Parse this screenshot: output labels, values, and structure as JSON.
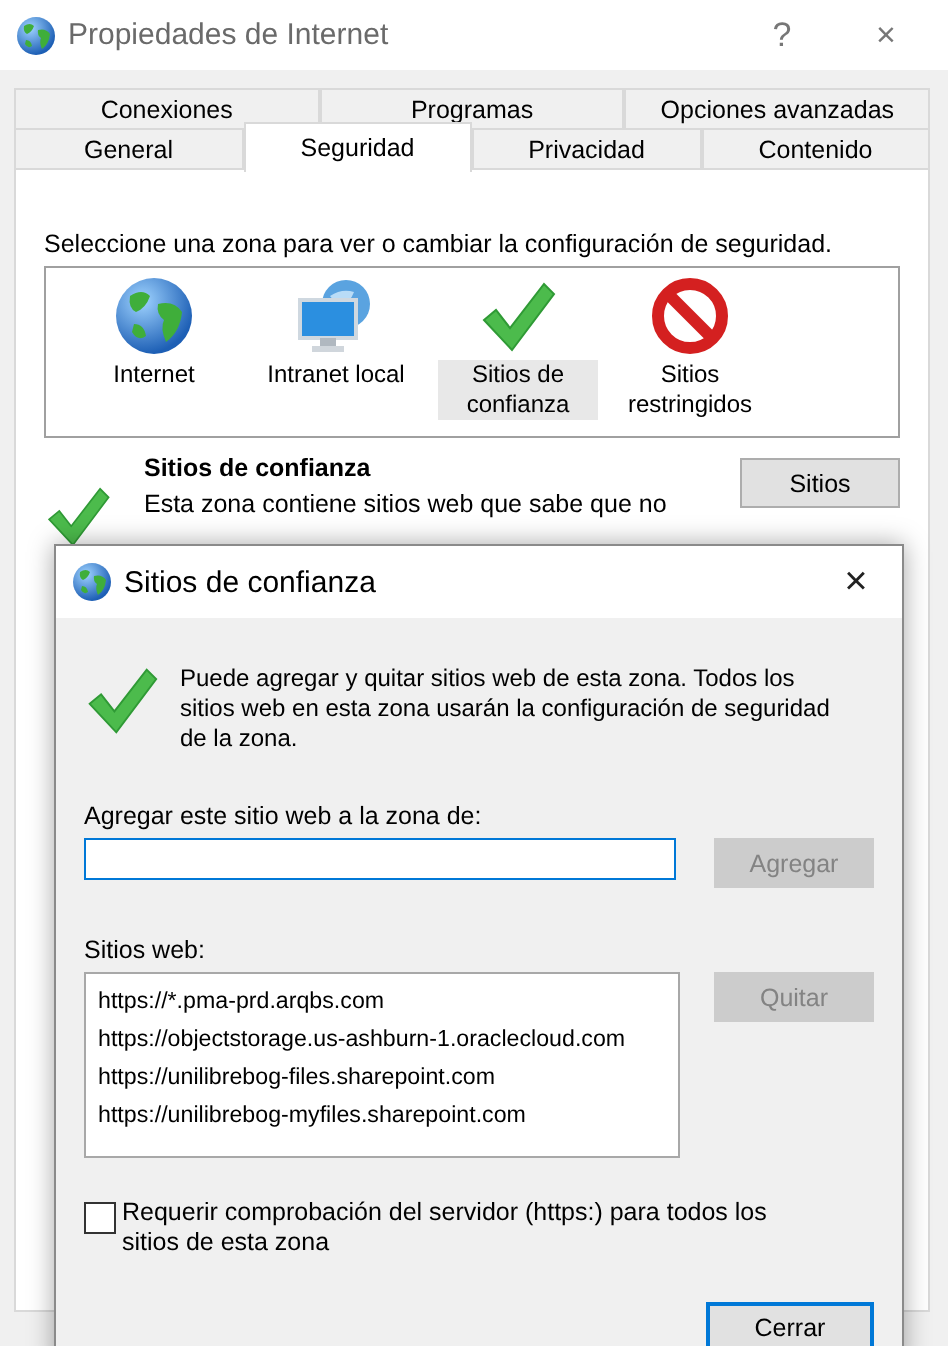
{
  "window": {
    "title": "Propiedades de Internet",
    "help": "?",
    "close": "×"
  },
  "tab_rows": [
    [
      {
        "label": "Conexiones",
        "selected": false
      },
      {
        "label": "Programas",
        "selected": false
      },
      {
        "label": "Opciones avanzadas",
        "selected": false
      }
    ],
    [
      {
        "label": "General",
        "selected": false
      },
      {
        "label": "Seguridad",
        "selected": true
      },
      {
        "label": "Privacidad",
        "selected": false
      },
      {
        "label": "Contenido",
        "selected": false
      }
    ]
  ],
  "security": {
    "instruction": "Seleccione una zona para ver o cambiar la configuración de seguridad.",
    "zones": [
      {
        "label": "Internet",
        "kind": "globe",
        "selected": false
      },
      {
        "label": "Intranet local",
        "kind": "network",
        "selected": false
      },
      {
        "label": "Sitios de confianza",
        "kind": "check",
        "selected": true
      },
      {
        "label": "Sitios restringidos",
        "kind": "blocked",
        "selected": false
      }
    ],
    "zone_title": "Sitios de confianza",
    "zone_description": "Esta zona contiene sitios web que sabe que no",
    "sites_button": "Sitios"
  },
  "dialog": {
    "title": "Sitios de confianza",
    "close": "×",
    "description": "Puede agregar y quitar sitios web de esta zona. Todos los sitios web en esta zona usarán la configuración de seguridad de la zona.",
    "add_label": "Agregar este sitio web a la zona de:",
    "add_button": {
      "label": "Agregar",
      "disabled": true
    },
    "sites_label": "Sitios web:",
    "sites": [
      "https://*.pma-prd.arqbs.com",
      "https://objectstorage.us-ashburn-1.oraclecloud.com",
      "https://unilibrebog-files.sharepoint.com",
      "https://unilibrebog-myfiles.sharepoint.com"
    ],
    "remove_button": {
      "label": "Quitar",
      "disabled": true
    },
    "https_check": {
      "label": "Requerir comprobación del servidor (https:) para todos los sitios de esta zona",
      "checked": false
    },
    "close_button": "Cerrar"
  }
}
